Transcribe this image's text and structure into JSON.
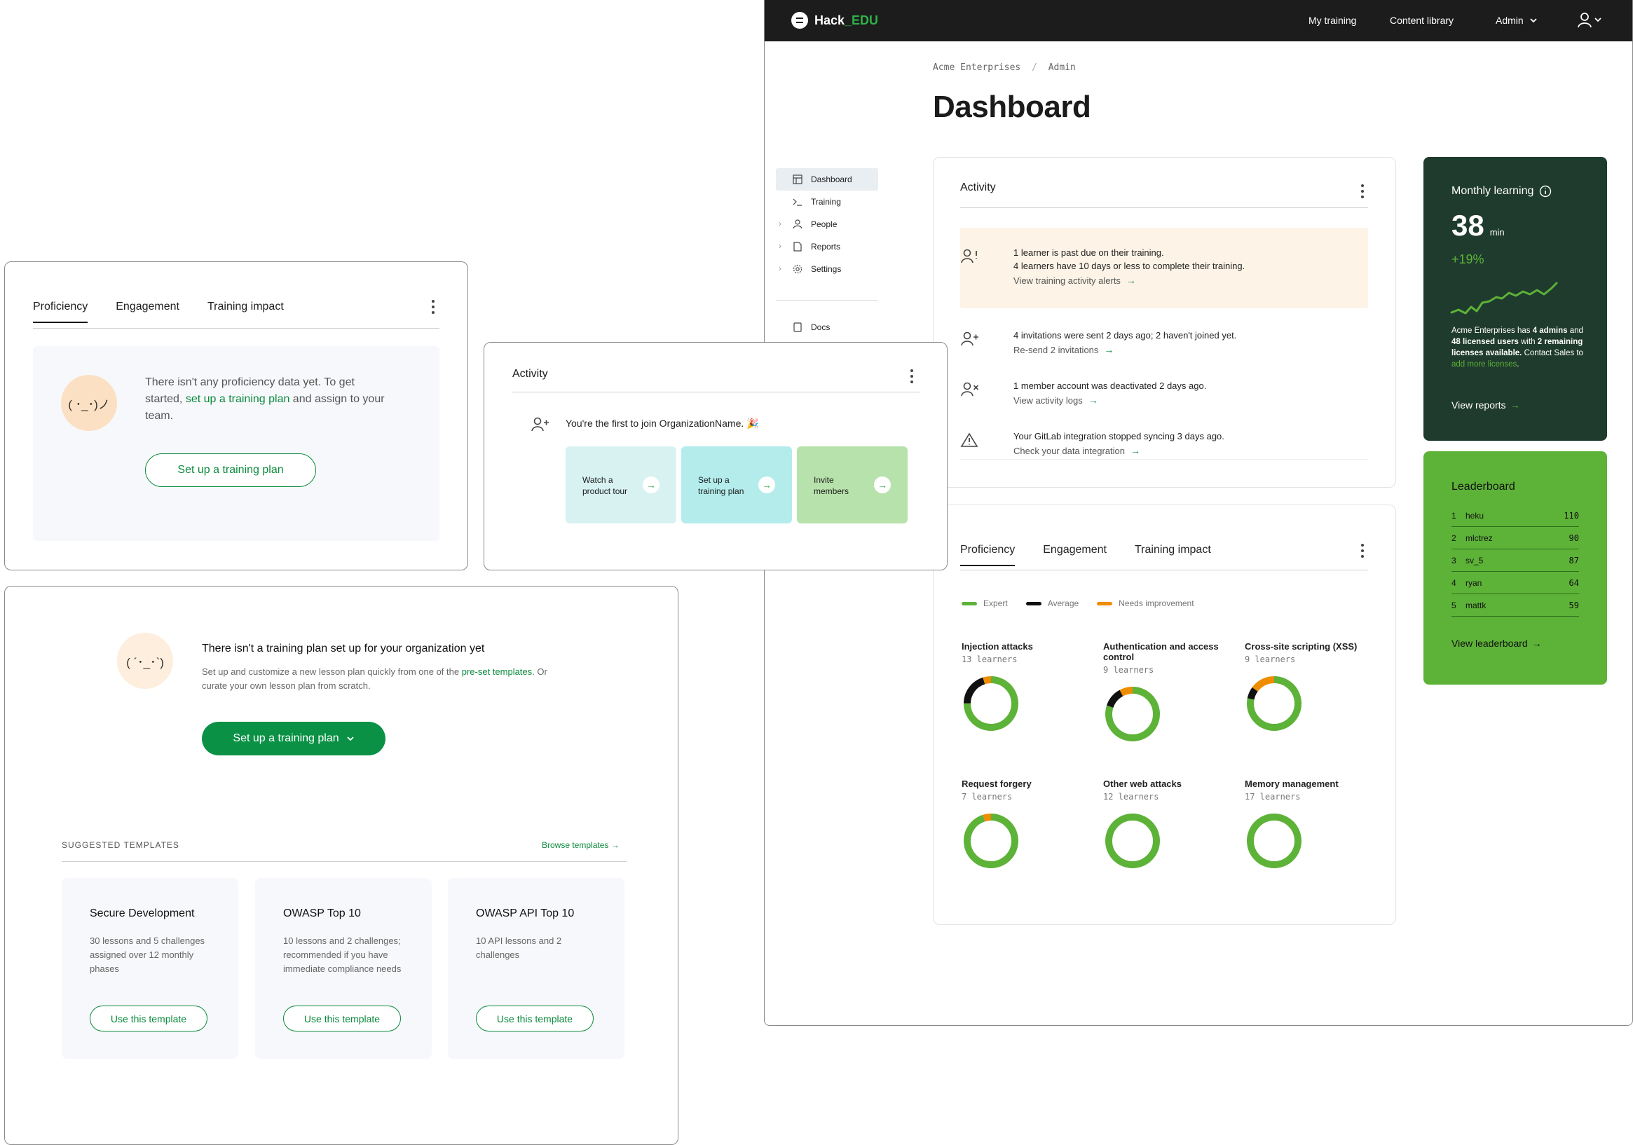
{
  "app": {
    "logo_a": "Hack",
    "logo_b": "_EDU",
    "nav": [
      "My training",
      "Content library",
      "Admin"
    ]
  },
  "sidebar": {
    "items": [
      {
        "label": "Dashboard",
        "icon": "dashboard-icon"
      },
      {
        "label": "Training",
        "icon": "terminal-icon"
      },
      {
        "label": "People",
        "icon": "person-icon"
      },
      {
        "label": "Reports",
        "icon": "document-icon"
      },
      {
        "label": "Settings",
        "icon": "gear-icon"
      }
    ],
    "docs": "Docs"
  },
  "breadcrumb": {
    "org": "Acme Enterprises",
    "sep": "/",
    "page": "Admin"
  },
  "page_title": "Dashboard",
  "activity": {
    "title": "Activity",
    "alert": {
      "line1": "1 learner is past due on their training.",
      "line2": "4 learners have 10 days or less to complete their training.",
      "link": "View training activity alerts"
    },
    "items": [
      {
        "text": "4 invitations were sent 2 days ago; 2 haven't joined yet.",
        "link": "Re-send 2 invitations",
        "icon": "add-user-icon"
      },
      {
        "text": "1 member account was deactivated 2 days ago.",
        "link": "View activity logs",
        "icon": "remove-user-icon"
      },
      {
        "text": "Your GitLab integration stopped syncing 3 days ago.",
        "link": "Check your data integration",
        "icon": "warning-icon"
      }
    ]
  },
  "proficiency": {
    "tabs": [
      "Proficiency",
      "Engagement",
      "Training impact"
    ],
    "legend": [
      "Expert",
      "Average",
      "Needs improvement"
    ],
    "colors": {
      "expert": "#5db238",
      "average": "#111111",
      "needs": "#f08c00"
    },
    "charts": [
      {
        "title": "Injection attacks",
        "learners": "13 learners",
        "expert": 0.75,
        "average": 0.2,
        "needs": 0.05
      },
      {
        "title": "Authentication and access control",
        "learners": "9 learners",
        "expert": 0.8,
        "average": 0.12,
        "needs": 0.08
      },
      {
        "title": "Cross-site scripting (XSS)",
        "learners": "9 learners",
        "expert": 0.78,
        "average": 0.07,
        "needs": 0.15
      },
      {
        "title": "Request forgery",
        "learners": "7 learners",
        "expert": 0.95,
        "average": 0,
        "needs": 0.05
      },
      {
        "title": "Other web attacks",
        "learners": "12 learners",
        "expert": 1,
        "average": 0,
        "needs": 0
      },
      {
        "title": "Memory management",
        "learners": "17 learners",
        "expert": 1,
        "average": 0,
        "needs": 0
      }
    ]
  },
  "monthly": {
    "title": "Monthly learning",
    "value": "38",
    "unit": "min",
    "change": "+19%",
    "text_a": "Acme Enterprises has ",
    "admins": "4 admins",
    "text_b": " and ",
    "licensed": "48 licensed users",
    "text_c": " with ",
    "remaining": "2 remaining licenses available.",
    "text_d": " Contact Sales to ",
    "add_link": "add more licenses",
    "text_e": ".",
    "link": "View reports"
  },
  "leaderboard": {
    "title": "Leaderboard",
    "rows": [
      {
        "rank": "1",
        "name": "heku",
        "score": "110"
      },
      {
        "rank": "2",
        "name": "mlctrez",
        "score": "90"
      },
      {
        "rank": "3",
        "name": "sv_5",
        "score": "87"
      },
      {
        "rank": "4",
        "name": "ryan",
        "score": "64"
      },
      {
        "rank": "5",
        "name": "mattk",
        "score": "59"
      }
    ],
    "link": "View leaderboard"
  },
  "prof_empty": {
    "tabs": [
      "Proficiency",
      "Engagement",
      "Training impact"
    ],
    "face": "( ･_･)ノ",
    "text_a": "There isn't any proficiency data yet. To get started, ",
    "link": "set up a training plan",
    "text_b": " and assign to your team.",
    "button": "Set up a training plan"
  },
  "activity_empty": {
    "title": "Activity",
    "message": "You're the first to join OrganizationName. 🎉",
    "actions": [
      {
        "label": "Watch a product tour",
        "color": "#d8f2f1"
      },
      {
        "label": "Set up a training plan",
        "color": "#b4ecec"
      },
      {
        "label": "Invite members",
        "color": "#b8e2ab"
      }
    ]
  },
  "plan": {
    "face": "( ´･_･`)",
    "title": "There isn't a training plan set up for your organization yet",
    "desc_a": "Set up and customize a new lesson plan quickly from one of the ",
    "desc_link": "pre-set templates",
    "desc_b": ". Or curate your own lesson plan from scratch.",
    "button": "Set up a training plan",
    "suggested": "SUGGESTED TEMPLATES",
    "browse": "Browse templates →",
    "templates": [
      {
        "title": "Secure Development",
        "desc": "30 lessons and 5 challenges assigned over 12 monthly phases",
        "button": "Use this template"
      },
      {
        "title": "OWASP Top 10",
        "desc": "10 lessons and 2 challenges; recommended if you have immediate compliance needs",
        "button": "Use this template"
      },
      {
        "title": "OWASP API Top 10",
        "desc": "10 API lessons and 2 challenges",
        "button": "Use this template"
      }
    ]
  }
}
